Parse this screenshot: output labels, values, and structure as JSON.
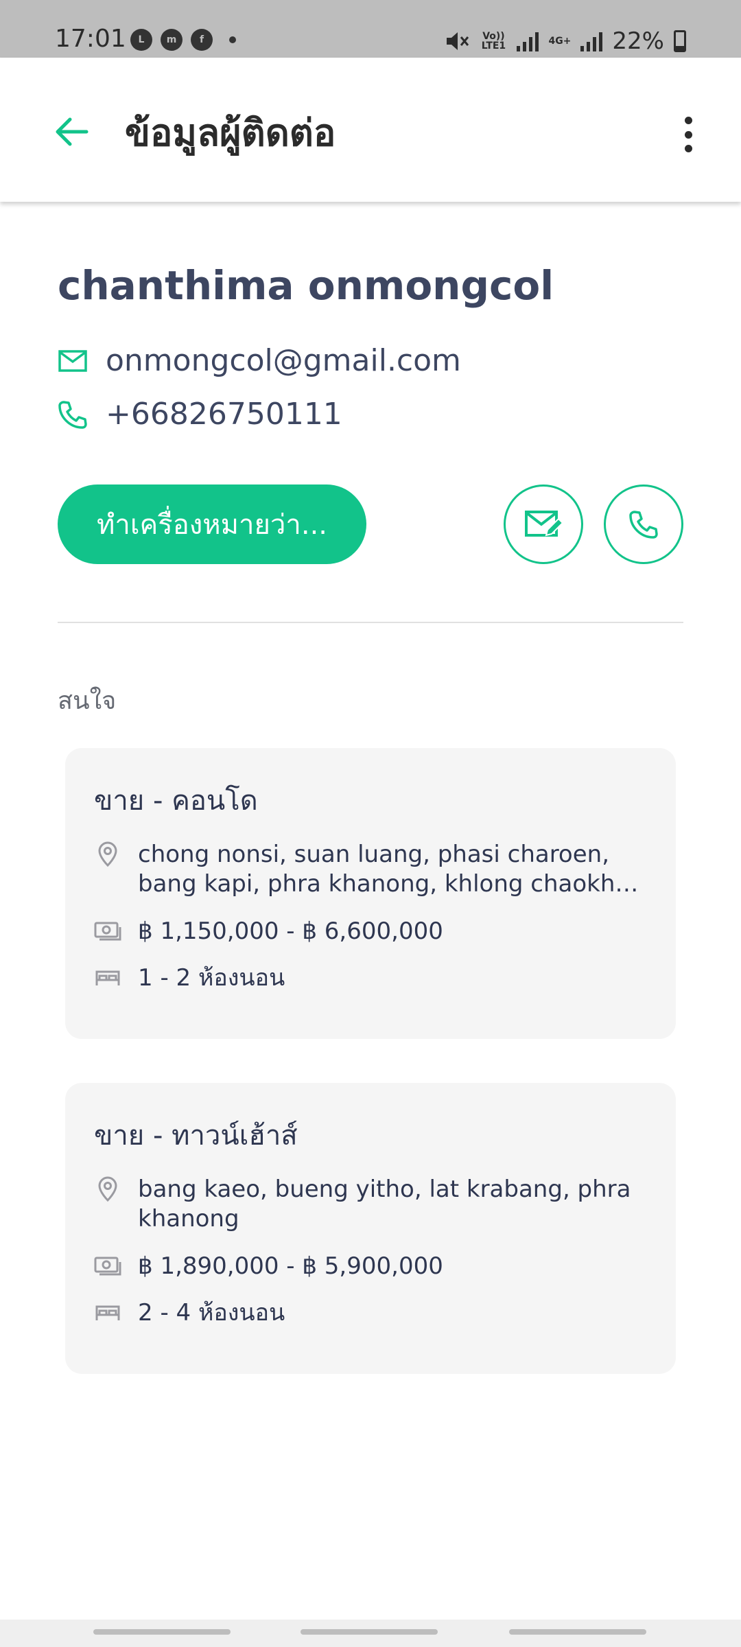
{
  "status_bar": {
    "time": "17:01",
    "app_icons": [
      "line-icon",
      "messenger-icon",
      "facebook-icon",
      "dot-icon"
    ],
    "network_label_1": "Vo)) LTE1",
    "network_label_2": "4G+",
    "battery": "22%"
  },
  "header": {
    "title": "ข้อมูลผู้ติดต่อ",
    "back_icon": "arrow-left-icon",
    "menu_icon": "more-vertical-icon"
  },
  "contact": {
    "name": "chanthima onmongcol",
    "email": "onmongcol@gmail.com",
    "phone": "+66826750111"
  },
  "actions": {
    "primary_label": "ทำเครื่องหมายว่า...",
    "email_icon": "edit-email-icon",
    "call_icon": "phone-icon"
  },
  "section": {
    "interest_label": "สนใจ"
  },
  "cards": [
    {
      "title": "ขาย - คอนโด",
      "locations": "chong nonsi, suan luang, phasi charoen, bang kapi, phra khanong, khlong chaokhun singh, bang na",
      "price": "฿ 1,150,000 - ฿ 6,600,000",
      "bedrooms": "1 - 2 ห้องนอน"
    },
    {
      "title": "ขาย - ทาวน์เฮ้าส์",
      "locations": "bang kaeo, bueng yitho, lat krabang, phra khanong",
      "price": "฿ 1,890,000 - ฿ 5,900,000",
      "bedrooms": "2 - 4 ห้องนอน"
    }
  ],
  "colors": {
    "accent": "#12c38a",
    "text": "#3d4661",
    "card_bg": "#f5f5f5"
  }
}
